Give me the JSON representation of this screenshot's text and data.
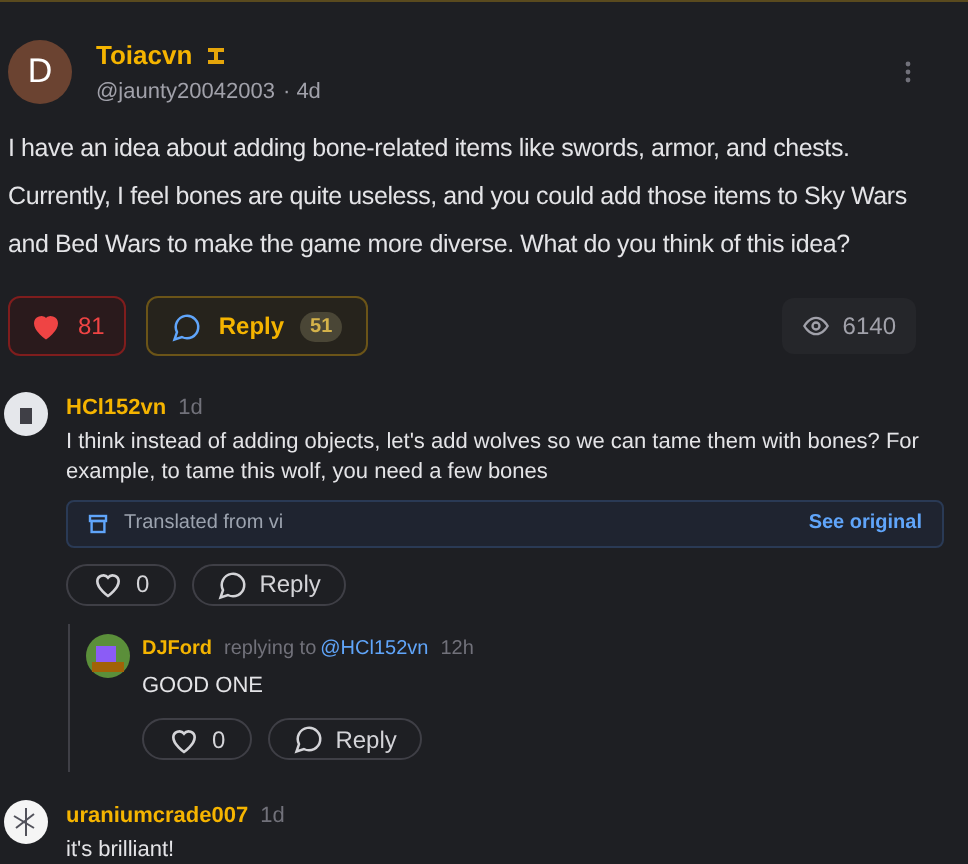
{
  "post": {
    "avatar_letter": "D",
    "author": "Toiacvn",
    "handle": "@jaunty20042003",
    "time": "· 4d",
    "body": "I have an idea about adding bone-related items like swords, armor, and chests. Currently, I feel bones are quite useless, and you could add those items to Sky Wars and Bed Wars to make the game more diverse. What do you think of this idea?",
    "likes": "81",
    "liked": true,
    "reply_label": "Reply",
    "reply_count": "51",
    "views": "6140"
  },
  "comments": [
    {
      "author": "HCl152vn",
      "time": "1d",
      "body": "I think instead of adding objects, let's add wolves so we can tame them with bones? For example, to tame this wolf, you need a few bones",
      "translation": {
        "label": "Translated from vi",
        "link": "See original"
      },
      "likes": "0",
      "liked": false,
      "reply_label": "Reply",
      "replies": [
        {
          "author": "DJFord",
          "replying_prefix": "replying to",
          "replying_to": "@HCl152vn",
          "time": "12h",
          "body": "GOOD ONE",
          "likes": "0",
          "liked": false,
          "reply_label": "Reply"
        }
      ]
    },
    {
      "author": "uraniumcrade007",
      "time": "1d",
      "body": "it's brilliant!"
    }
  ]
}
